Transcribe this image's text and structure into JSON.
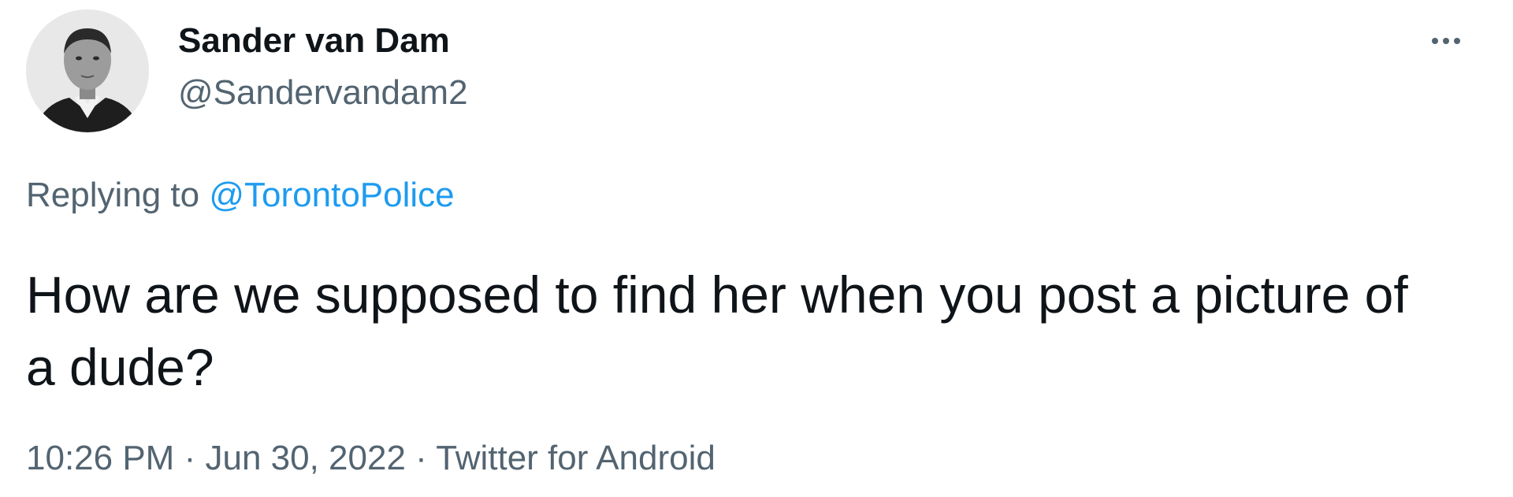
{
  "author": {
    "display_name": "Sander van Dam",
    "handle": "@Sandervandam2",
    "avatar_icon": "profile-photo"
  },
  "more_icon": "more-horizontal-icon",
  "reply": {
    "prefix": "Replying to",
    "target": "@TorontoPolice"
  },
  "text": "How are we supposed to find her when you post a picture of a dude?",
  "meta": {
    "time": "10:26 PM",
    "separator": "·",
    "date": "Jun 30, 2022",
    "source": "Twitter for Android"
  },
  "colors": {
    "link": "#1d9bf0",
    "secondary_text": "#536471",
    "primary_text": "#0f1419"
  }
}
